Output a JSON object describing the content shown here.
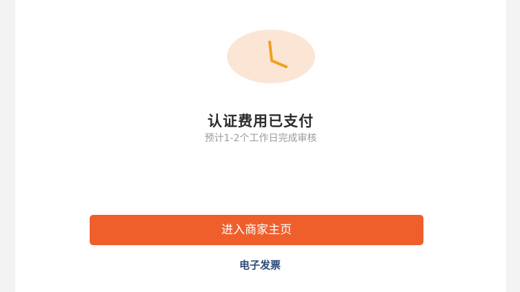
{
  "status": {
    "icon": "clock-icon",
    "title": "认证费用已支付",
    "subtitle": "预计1-2个工作日完成审核"
  },
  "actions": {
    "primary_label": "进入商家主页",
    "secondary_label": "电子发票"
  },
  "colors": {
    "accent": "#ef5f2c",
    "icon_bg": "#fbe6d6",
    "icon_stroke": "#f0a020",
    "link": "#2d4a78"
  }
}
